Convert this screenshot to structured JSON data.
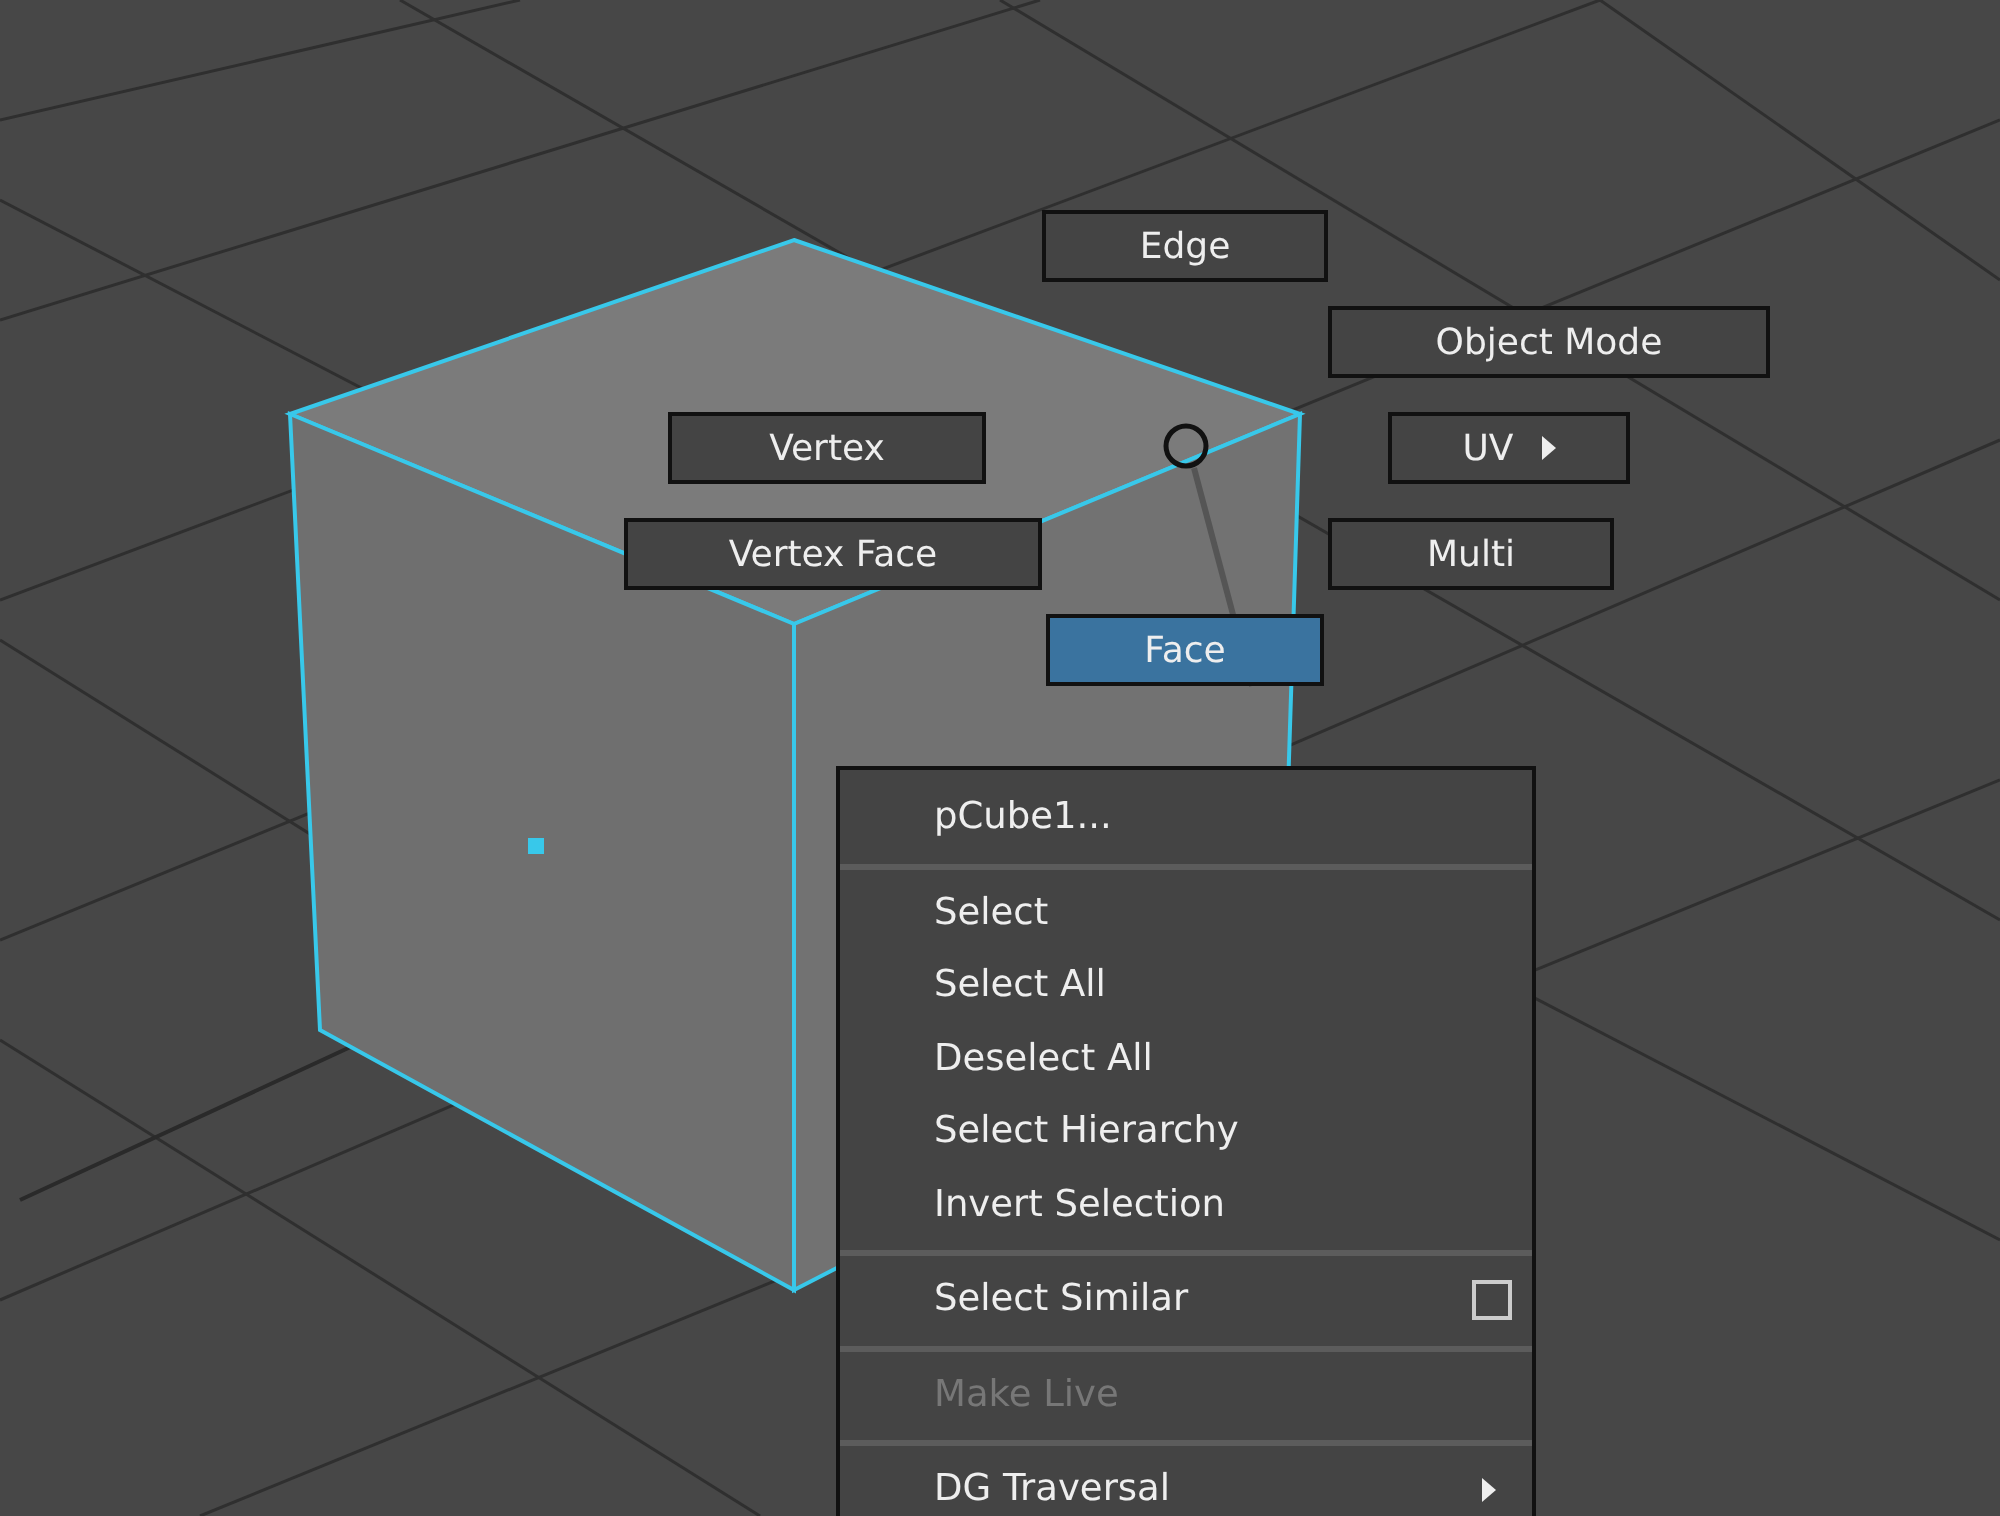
{
  "marking_menu": [
    {
      "label": "Edge",
      "selected": false,
      "submenu": false
    },
    {
      "label": "Object Mode",
      "selected": false,
      "submenu": false
    },
    {
      "label": "Vertex",
      "selected": false,
      "submenu": false
    },
    {
      "label": "UV",
      "selected": false,
      "submenu": true
    },
    {
      "label": "Vertex Face",
      "selected": false,
      "submenu": false
    },
    {
      "label": "Multi",
      "selected": false,
      "submenu": false
    },
    {
      "label": "Face",
      "selected": true,
      "submenu": false
    }
  ],
  "context_menu": {
    "sections": [
      [
        {
          "label": "pCube1...",
          "disabled": false,
          "option_box": false,
          "submenu": false
        }
      ],
      [
        {
          "label": "Select",
          "disabled": false,
          "option_box": false,
          "submenu": false
        },
        {
          "label": "Select All",
          "disabled": false,
          "option_box": false,
          "submenu": false
        },
        {
          "label": "Deselect All",
          "disabled": false,
          "option_box": false,
          "submenu": false
        },
        {
          "label": "Select Hierarchy",
          "disabled": false,
          "option_box": false,
          "submenu": false
        },
        {
          "label": "Invert Selection",
          "disabled": false,
          "option_box": false,
          "submenu": false
        }
      ],
      [
        {
          "label": "Select Similar",
          "disabled": false,
          "option_box": true,
          "submenu": false
        }
      ],
      [
        {
          "label": "Make Live",
          "disabled": true,
          "option_box": false,
          "submenu": false
        }
      ],
      [
        {
          "label": "DG Traversal",
          "disabled": false,
          "option_box": false,
          "submenu": true
        }
      ]
    ]
  }
}
